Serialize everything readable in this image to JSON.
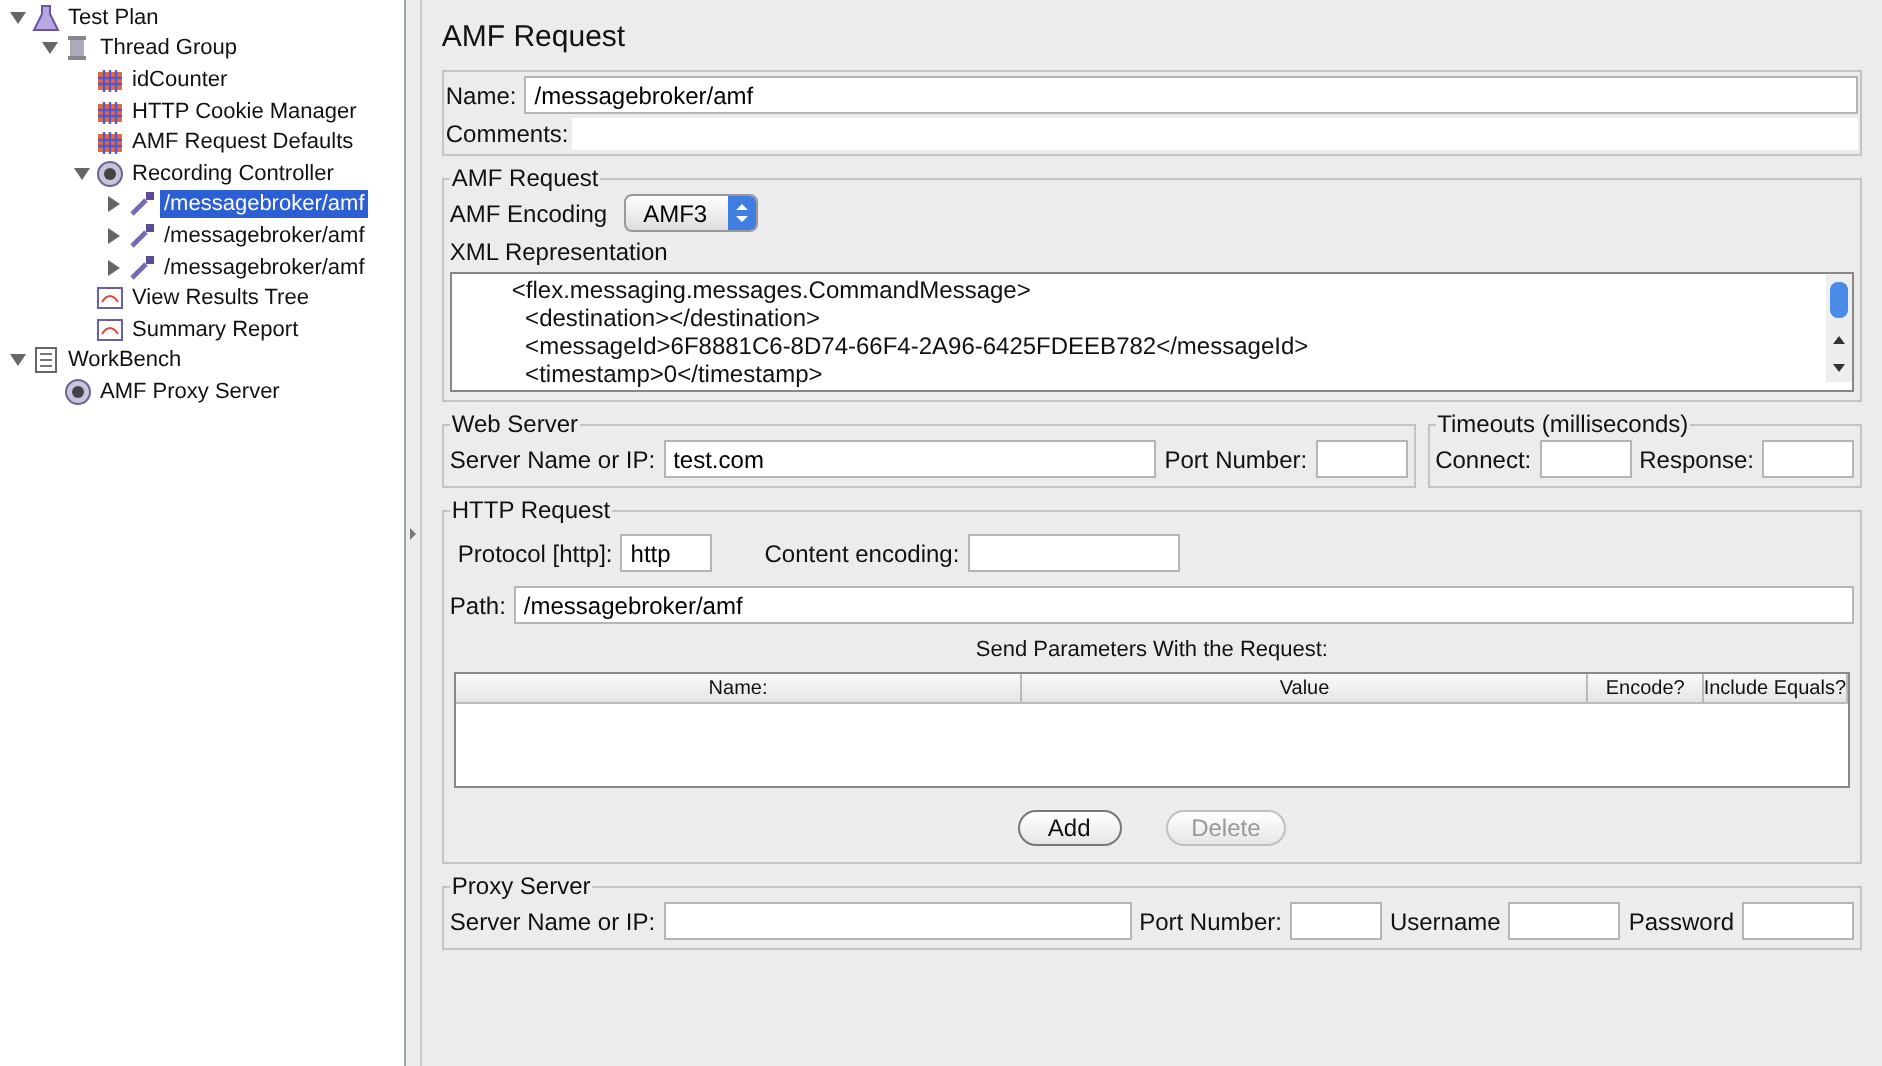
{
  "tree": [
    {
      "label": "Test Plan",
      "kind": "plan",
      "expanded": true,
      "selected": false,
      "children": [
        {
          "label": "Thread Group",
          "kind": "thread",
          "expanded": true,
          "selected": false,
          "children": [
            {
              "label": "idCounter",
              "kind": "config",
              "selected": false
            },
            {
              "label": "HTTP Cookie Manager",
              "kind": "config",
              "selected": false
            },
            {
              "label": "AMF Request Defaults",
              "kind": "config",
              "selected": false
            },
            {
              "label": "Recording Controller",
              "kind": "controller",
              "expanded": true,
              "selected": false,
              "children": [
                {
                  "label": "/messagebroker/amf",
                  "kind": "sampler",
                  "expanded": false,
                  "selected": true
                },
                {
                  "label": "/messagebroker/amf",
                  "kind": "sampler",
                  "expanded": false,
                  "selected": false
                },
                {
                  "label": "/messagebroker/amf",
                  "kind": "sampler",
                  "expanded": false,
                  "selected": false
                }
              ]
            },
            {
              "label": "View Results Tree",
              "kind": "listener",
              "selected": false
            },
            {
              "label": "Summary Report",
              "kind": "listener",
              "selected": false
            }
          ]
        }
      ]
    },
    {
      "label": "WorkBench",
      "kind": "workbench",
      "expanded": true,
      "selected": false,
      "children": [
        {
          "label": "AMF Proxy Server",
          "kind": "controller",
          "selected": false
        }
      ]
    }
  ],
  "panel": {
    "title": "AMF Request",
    "name": {
      "label": "Name:",
      "value": "/messagebroker/amf"
    },
    "comments": {
      "label": "Comments:"
    },
    "amf_request": {
      "legend": "AMF Request",
      "encoding_label": "AMF Encoding",
      "encoding": "AMF3",
      "xml_label": "XML Representation",
      "xml_lines": [
        "<flex.messaging.messages.CommandMessage>",
        "  <destination></destination>",
        "  <messageId>6F8881C6-8D74-66F4-2A96-6425FDEEB782</messageId>",
        "  <timestamp>0</timestamp>"
      ]
    },
    "web_server": {
      "legend": "Web Server",
      "server_label": "Server Name or IP:",
      "server": "test.com",
      "port_label": "Port Number:"
    },
    "timeouts": {
      "legend": "Timeouts (milliseconds)",
      "connect_label": "Connect:",
      "response_label": "Response:"
    },
    "http_request": {
      "legend": "HTTP Request",
      "protocol_label": "Protocol [http]:",
      "protocol": "http",
      "encoding_label": "Content encoding:",
      "path_label": "Path:",
      "path": "/messagebroker/amf",
      "params_title": "Send Parameters With the Request:",
      "columns": [
        "Name:",
        "Value",
        "Encode?",
        "Include Equals?"
      ],
      "buttons": [
        {
          "label": "Add",
          "disabled": false
        },
        {
          "label": "Delete",
          "disabled": true
        }
      ]
    },
    "proxy_server": {
      "legend": "Proxy Server",
      "server_label": "Server Name or IP:",
      "port_label": "Port Number:",
      "username_label": "Username",
      "password_label": "Password"
    }
  }
}
